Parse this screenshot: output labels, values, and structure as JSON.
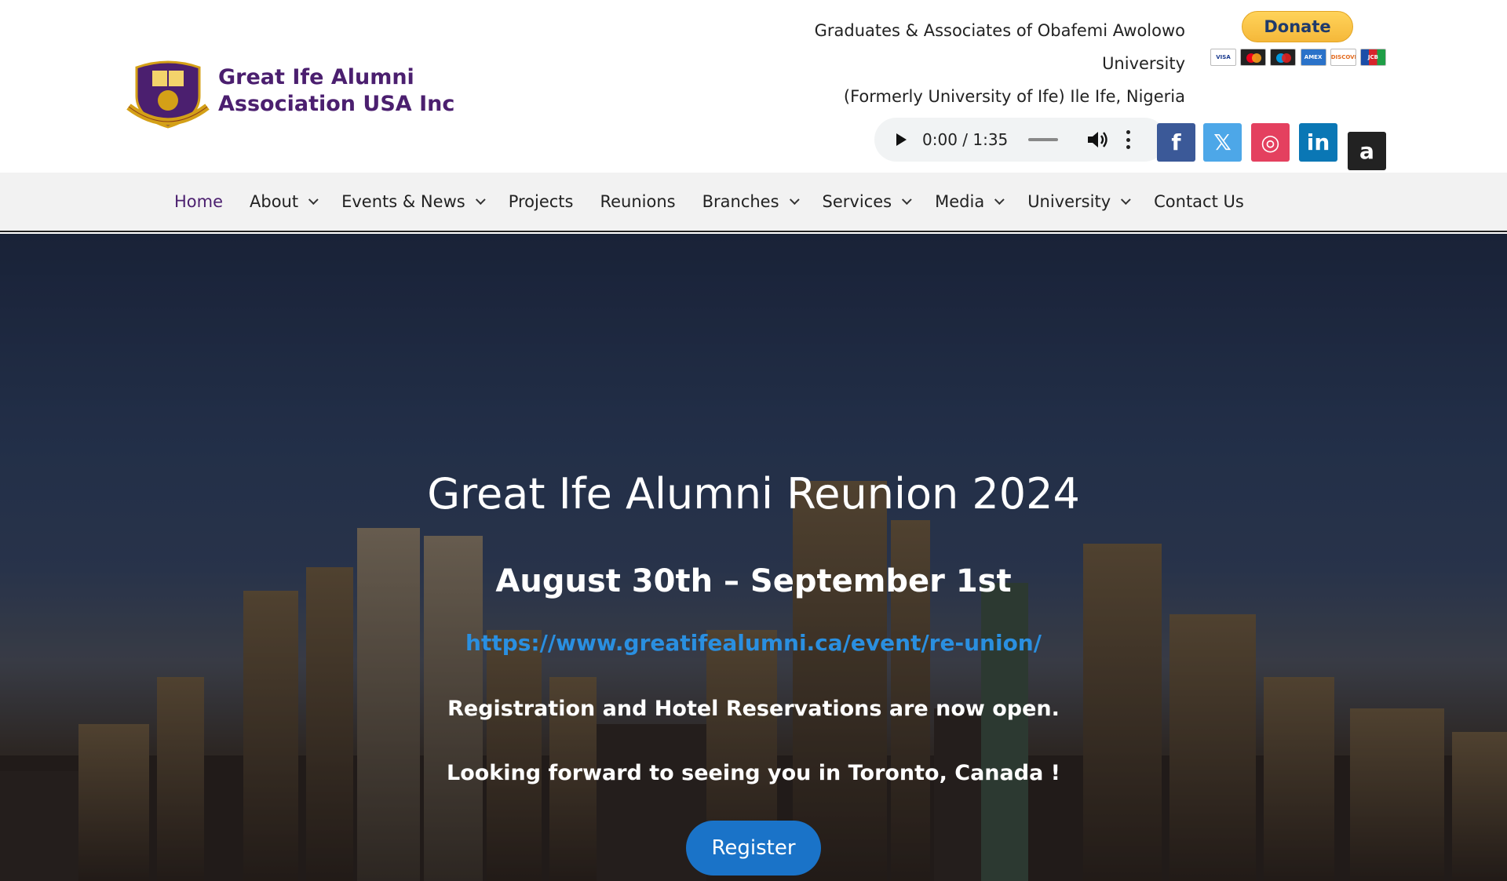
{
  "brand": {
    "name_line1": "Great Ife Alumni",
    "name_line2": "Association USA Inc",
    "emblem_color": "#4b1f6f",
    "emblem_accent": "#d4a017"
  },
  "tagline": {
    "line1": "Graduates & Associates of Obafemi Awolowo",
    "line2": "University",
    "line3": "(Formerly University of Ife) Ile Ife, Nigeria"
  },
  "donate": {
    "label": "Donate",
    "cards": [
      "VISA",
      "mastercard",
      "maestro",
      "AMEX",
      "DISCOVER",
      "JCB"
    ]
  },
  "audio_player": {
    "time": "0:00 / 1:35"
  },
  "social": [
    {
      "name": "facebook-icon",
      "glyph": "f"
    },
    {
      "name": "x-twitter-icon",
      "glyph": "𝕏"
    },
    {
      "name": "instagram-icon",
      "glyph": "◎"
    },
    {
      "name": "linkedin-icon",
      "glyph": "in"
    },
    {
      "name": "amazon-icon",
      "glyph": "a"
    }
  ],
  "nav": {
    "items": [
      {
        "label": "Home",
        "dropdown": false,
        "active": true
      },
      {
        "label": "About",
        "dropdown": true
      },
      {
        "label": "Events & News",
        "dropdown": true
      },
      {
        "label": "Projects",
        "dropdown": false
      },
      {
        "label": "Reunions",
        "dropdown": false
      },
      {
        "label": "Branches",
        "dropdown": true
      },
      {
        "label": "Services",
        "dropdown": true
      },
      {
        "label": "Media",
        "dropdown": true
      },
      {
        "label": "University",
        "dropdown": true
      },
      {
        "label": "Contact Us",
        "dropdown": false
      }
    ]
  },
  "hero": {
    "title": "Great Ife Alumni Reunion 2024",
    "date": "August 30th – September 1st",
    "link": "https://www.greatifealumni.ca/event/re-union/",
    "line1": "Registration and Hotel Reservations are now open.",
    "line2": "Looking forward to seeing you in Toronto, Canada !",
    "register_label": "Register",
    "link_color": "#2a8fe0",
    "button_color": "#1a73c8"
  }
}
